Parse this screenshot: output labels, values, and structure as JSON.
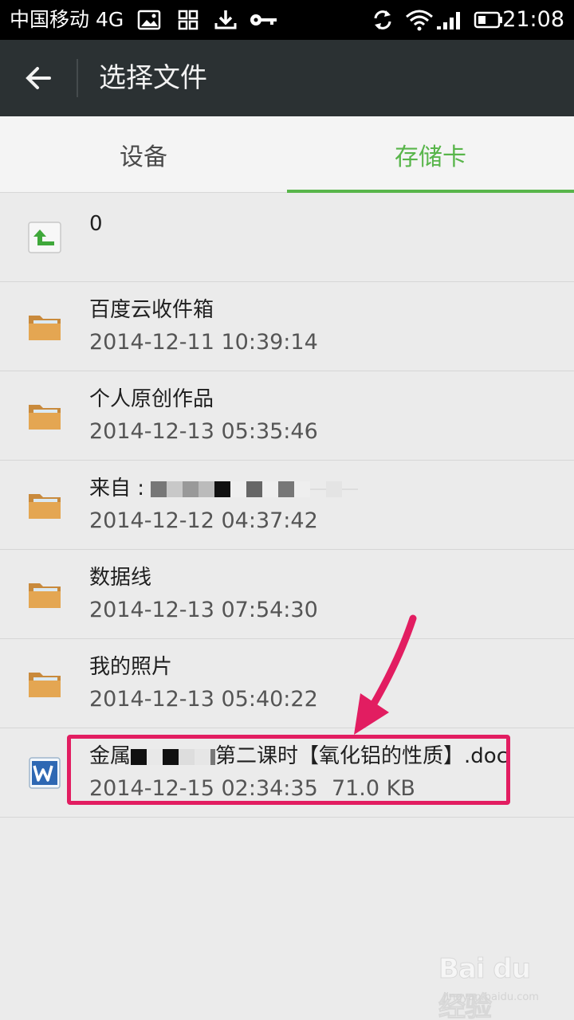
{
  "status_bar": {
    "carrier": "中国移动 4G",
    "time": "21:08",
    "icons": [
      "image-icon",
      "apps-icon",
      "download-icon",
      "key-icon",
      "sync-icon",
      "wifi-icon",
      "signal-icon",
      "battery-icon"
    ]
  },
  "title_bar": {
    "back_icon": "arrow-left-icon",
    "title": "选择文件"
  },
  "tabs": [
    {
      "label": "设备",
      "active": false
    },
    {
      "label": "存储卡",
      "active": true
    }
  ],
  "colors": {
    "accent": "#58b54a",
    "title_bar": "#2b3133",
    "highlight": "#e21d61",
    "folder": "#e0a14a"
  },
  "parent_row": {
    "icon": "up-folder-icon",
    "name": "0"
  },
  "folders": [
    {
      "name": "百度云收件箱",
      "date": "2014-12-11 10:39:14"
    },
    {
      "name": "个人原创作品",
      "date": "2014-12-13 05:35:46"
    },
    {
      "name_prefix": "来自 :",
      "date": "2014-12-12 04:37:42"
    },
    {
      "name": "数据线",
      "date": "2014-12-13 07:54:30"
    },
    {
      "name": "我的照片",
      "date": "2014-12-13 05:40:22"
    }
  ],
  "doc_file": {
    "icon": "word-doc-icon",
    "name_prefix": "金属",
    "name_suffix": "第二课时【氧化铝的性质】.doc",
    "date": "2014-12-15 02:34:35",
    "size": "71.0 KB"
  },
  "watermark": {
    "logo": "Bai du 经验",
    "url": "jingyan.baidu.com"
  }
}
